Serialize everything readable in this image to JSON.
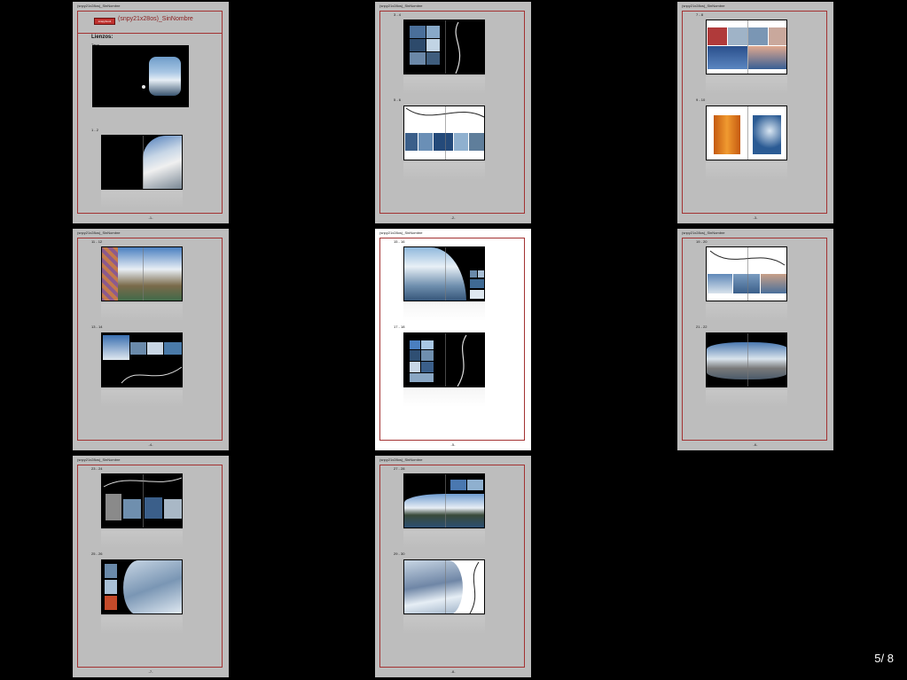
{
  "pager": {
    "current": "5",
    "separator": "/",
    "total": "8"
  },
  "doc_title": "(snpy21x28os)_SinNombre",
  "cover": {
    "logo_text": "snapybook",
    "title": "(snpy21x28os)_SinNombre",
    "heading": "Lienzos:",
    "cover_label": "Tapa",
    "first_spread_label": "1 - 2"
  },
  "pages": [
    {
      "number": "-1-",
      "spreads": [
        "Tapa",
        "1 - 2"
      ]
    },
    {
      "number": "-2-",
      "spreads": [
        "3 - 4",
        "5 - 6"
      ]
    },
    {
      "number": "-3-",
      "spreads": [
        "7 - 8",
        "9 - 10"
      ]
    },
    {
      "number": "-4-",
      "spreads": [
        "11 - 12",
        "13 - 14"
      ]
    },
    {
      "number": "-5-",
      "spreads": [
        "15 - 16",
        "17 - 18"
      ]
    },
    {
      "number": "-6-",
      "spreads": [
        "19 - 20",
        "21 - 22"
      ]
    },
    {
      "number": "-7-",
      "spreads": [
        "23 - 24",
        "25 - 26"
      ]
    },
    {
      "number": "-8-",
      "spreads": [
        "27 - 28",
        "29 - 30"
      ]
    }
  ],
  "colors": {
    "frame": "#a33232",
    "page_bg": "#bdbdbd",
    "current_page_bg": "#ffffff",
    "accent": "#c0322f"
  }
}
